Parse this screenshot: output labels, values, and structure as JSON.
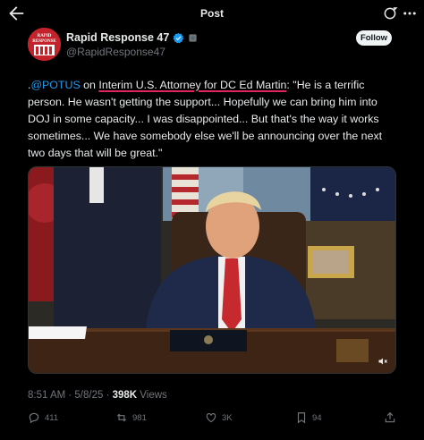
{
  "header": {
    "title": "Post"
  },
  "author": {
    "name": "Rapid Response 47",
    "handle": "@RapidResponse47",
    "avatar_text_1": "RAPID",
    "avatar_text_2": "RESPONSE",
    "avatar_number": "47"
  },
  "follow_label": "Follow",
  "tweet": {
    "prefix": ".",
    "mention": "@POTUS",
    "on": " on ",
    "underlined": "Interim U.S. Attorney for DC Ed Martin",
    "quote": ": \"He is a terrific person. He wasn't getting the support... Hopefully we can bring him into DOJ in some capacity... I was disappointed... But that's the way it works sometimes... We have somebody else we'll be announcing over the next two days that will be great.\""
  },
  "meta": {
    "time": "8:51 AM · 5/8/25 · ",
    "views_count": "398K",
    "views_label": " Views"
  },
  "actions": {
    "replies": "411",
    "reposts": "981",
    "likes": "3K",
    "bookmarks": "94"
  },
  "colors": {
    "accent": "#1d9bf0",
    "underline": "#e0245e",
    "bg": "#000000"
  }
}
